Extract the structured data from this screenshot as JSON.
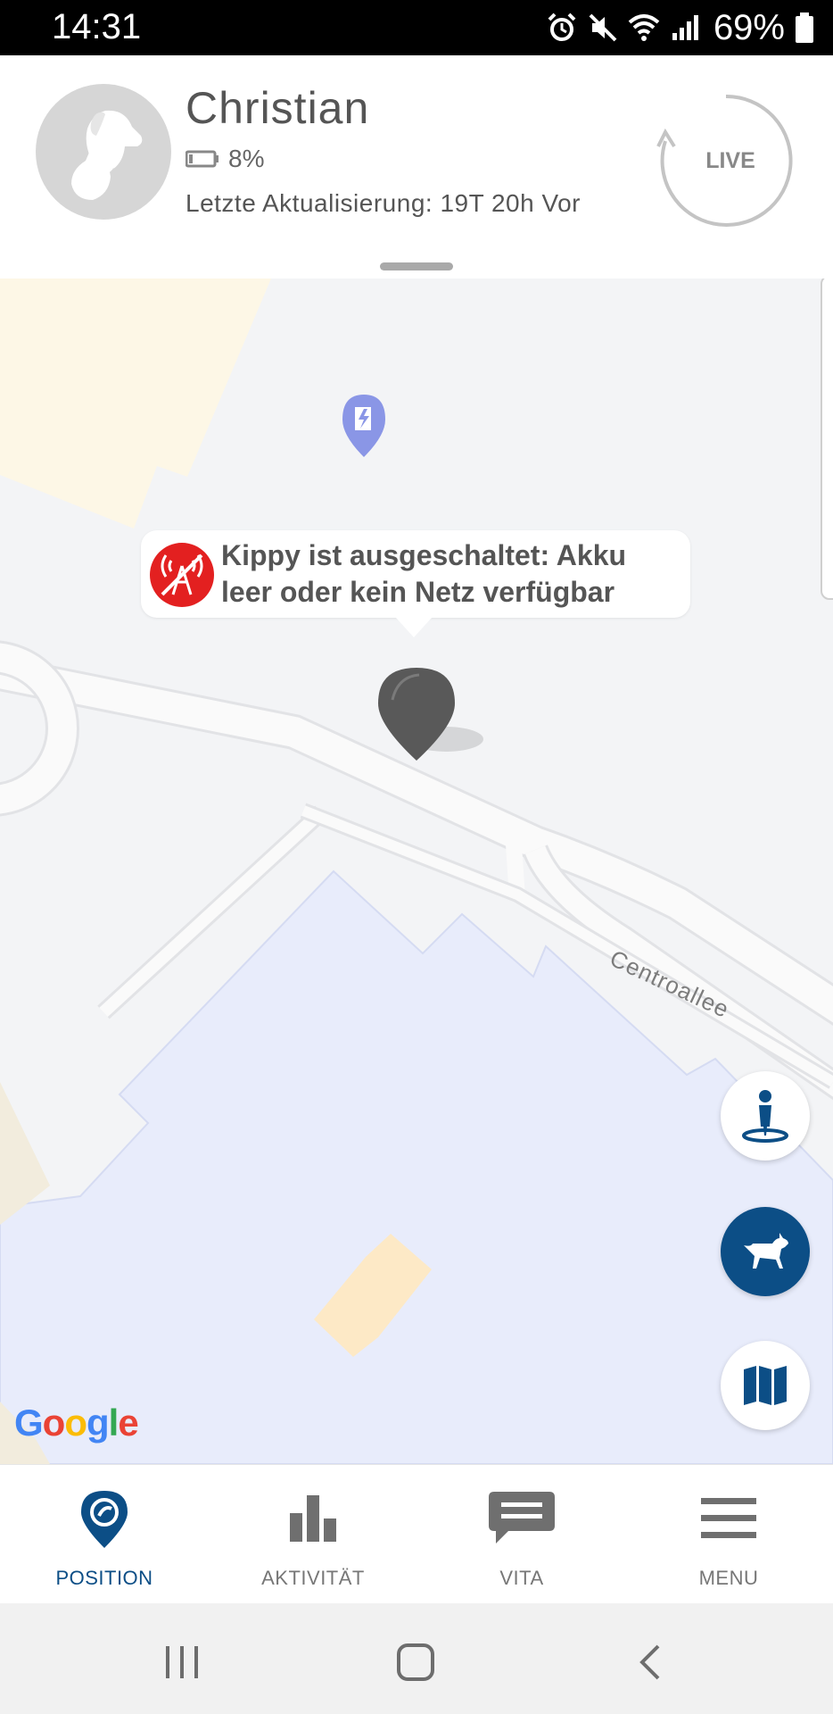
{
  "status_bar": {
    "time": "14:31",
    "battery_percent": "69%",
    "icons": [
      "alarm-icon",
      "mute-icon",
      "wifi-icon",
      "cell-signal-icon",
      "battery-icon"
    ]
  },
  "profile": {
    "name": "Christian",
    "battery": "8%",
    "battery_level": 0.08,
    "last_update": "Letzte Aktualisierung: 19T 20h Vor",
    "live_label": "LIVE"
  },
  "map": {
    "alert_text": "Kippy ist ausgeschaltet: Akku leer oder kein Netz verfügbar",
    "street_name": "Centroallee",
    "google_logo": [
      "G",
      "o",
      "o",
      "g",
      "l",
      "e"
    ],
    "google_colors": [
      "#4285F4",
      "#EA4335",
      "#FBBC05",
      "#4285F4",
      "#34A853",
      "#EA4335"
    ],
    "poi_icon": "ev-charging-station-icon",
    "fabs": [
      "person-location-icon",
      "dog-location-icon",
      "map-layers-icon"
    ]
  },
  "tabs": [
    {
      "label": "POSITION",
      "icon": "position-pin-icon",
      "active": true
    },
    {
      "label": "AKTIVITÄT",
      "icon": "bar-chart-icon",
      "active": false
    },
    {
      "label": "VITA",
      "icon": "chat-bubble-icon",
      "active": false
    },
    {
      "label": "MENU",
      "icon": "hamburger-menu-icon",
      "active": false
    }
  ],
  "colors": {
    "accent": "#0c4e86",
    "alert_red": "#e32020",
    "building": "#e8ecfb",
    "park": "#fdf7e6"
  }
}
